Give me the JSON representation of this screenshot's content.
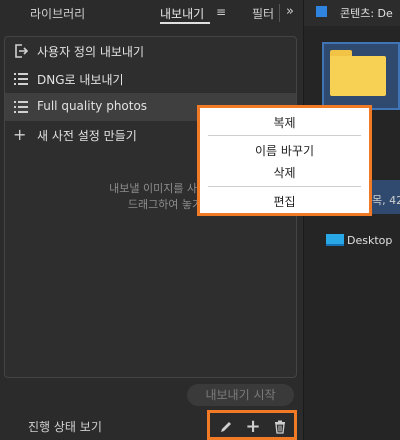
{
  "tabs": [
    {
      "label": "라이브러리"
    },
    {
      "label": "내보내기"
    },
    {
      "label": "필터"
    }
  ],
  "tab_menu_glyph": "≡",
  "tab_overflow": "»",
  "presets": {
    "items": [
      {
        "label": "사용자 정의 내보내기",
        "icon": "export-icon"
      },
      {
        "label": "DNG로 내보내기",
        "icon": "list-icon"
      },
      {
        "label": "Full quality photos",
        "icon": "list-icon"
      },
      {
        "label": "새 사전 설정 만들기",
        "icon": "plus-icon"
      }
    ],
    "hint_line1": "내보낼 이미지를 사전 설",
    "hint_line2": "드래그하여 놓기"
  },
  "start_button": "내보내기 시작",
  "progress_label": "진행 상태 보기",
  "tools": {
    "edit": "✎",
    "add": "+",
    "delete": "🗑"
  },
  "right_panel": {
    "title": "콘텐츠: De",
    "count_fragment": "목, 42",
    "desktop_label": "Desktop"
  },
  "context_menu": {
    "duplicate": "복제",
    "rename": "이름 바꾸기",
    "delete": "삭제",
    "edit": "편집"
  },
  "colors": {
    "highlight": "#f07a26",
    "accent": "#2f84e0"
  }
}
